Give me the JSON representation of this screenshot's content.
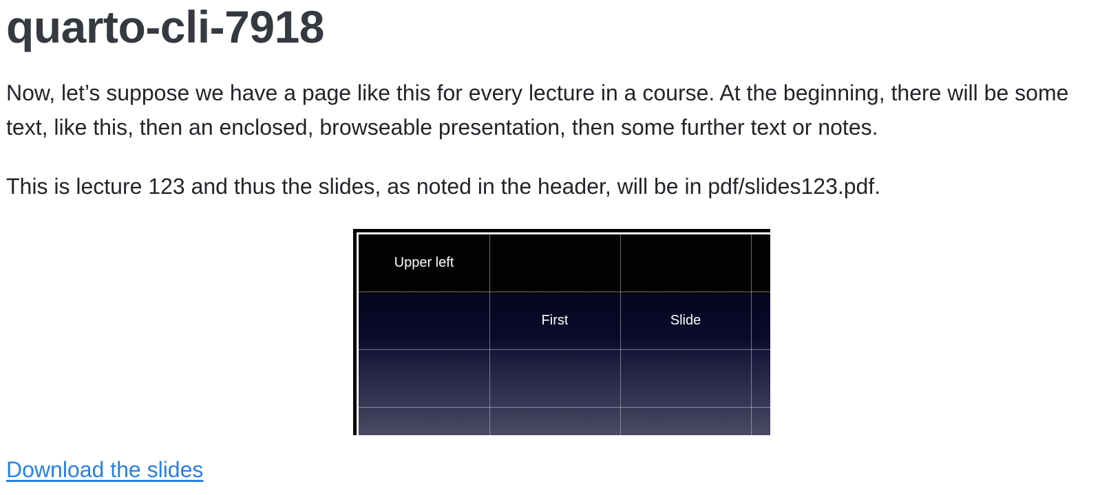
{
  "page": {
    "title": "quarto-cli-7918",
    "paragraphs": [
      "Now, let’s suppose we have a page like this for every lecture in a course. At the beginning, there will be some text, like this, then an enclosed, browseable presentation, then some further text or notes.",
      "This is lecture 123 and thus the slides, as noted in the header, will be in pdf/slides123.pdf."
    ]
  },
  "slide": {
    "cells": {
      "upper_left": "Upper left",
      "first": "First",
      "slide": "Slide"
    },
    "colors": {
      "top_band": "#030303",
      "middle_band": "#0a0a2c",
      "bottom_band": "#4a4a63",
      "grid": "#c8c8d2"
    }
  },
  "links": {
    "download": "Download the slides"
  },
  "colors": {
    "link": "#2780e3",
    "heading": "#343a40",
    "text": "#212529"
  }
}
